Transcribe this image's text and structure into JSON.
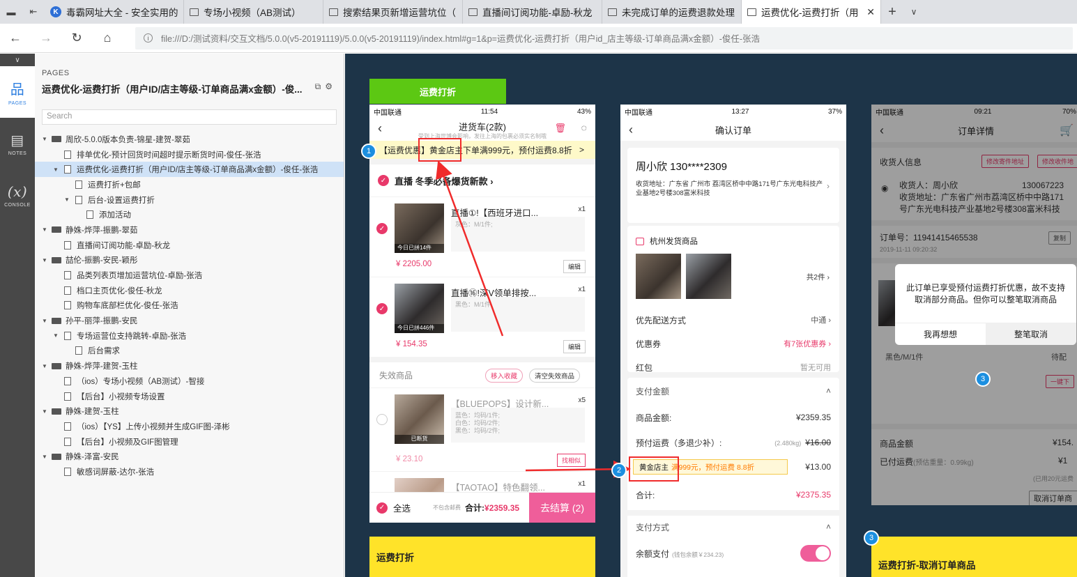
{
  "browser": {
    "tabs": [
      {
        "title": "毒霸网址大全 - 安全实用的",
        "icon": "kingsoft-k-icon"
      },
      {
        "title": "专场小视频（AB测试）",
        "icon": "page-icon"
      },
      {
        "title": "搜索结果页新增运营坑位（",
        "icon": "page-icon"
      },
      {
        "title": "直播间订阅功能-卓励-秋龙",
        "icon": "page-icon"
      },
      {
        "title": "未完成订单的运费退款处理",
        "icon": "page-icon"
      },
      {
        "title": "运费优化-运费打折（用",
        "icon": "page-icon",
        "active": true
      }
    ],
    "url": "file:///D:/测试资料/交互文档/5.0.0(v5-20191119)/5.0.0(v5-20191119)/index.html#g=1&p=运费优化-运费打折（用户id_店主等级-订单商品满x金额）-俊任-张浩"
  },
  "rail": {
    "items": [
      {
        "label": "PAGES",
        "icon": "sitemap-icon",
        "active": true
      },
      {
        "label": "NOTES",
        "icon": "notes-icon"
      },
      {
        "label": "CONSOLE",
        "icon": "variable-x-icon",
        "glyph": "(x)"
      }
    ]
  },
  "sitemap": {
    "header": "PAGES",
    "page_title": "运费优化-运费打折（用户ID/店主等级-订单商品满x金额）-俊...",
    "search_placeholder": "Search",
    "nodes": [
      {
        "label": "周欣-5.0.0版本负责-锦星-建贺-翠茹",
        "level": 0,
        "type": "folder",
        "expanded": true
      },
      {
        "label": "排单优化-预计回货时间超时提示断货时间-俊任-张浩",
        "level": 1,
        "type": "page"
      },
      {
        "label": "运费优化-运费打折（用户ID/店主等级-订单商品满x金额）-俊任-张浩",
        "level": 1,
        "type": "page",
        "expanded": true,
        "selected": true
      },
      {
        "label": "运费打折+包邮",
        "level": 2,
        "type": "page"
      },
      {
        "label": "后台-设置运费打折",
        "level": 2,
        "type": "page",
        "expanded": true
      },
      {
        "label": "添加活动",
        "level": 3,
        "type": "page"
      },
      {
        "label": "静姝-烨萍-振鹏-翠茹",
        "level": 0,
        "type": "folder",
        "expanded": true
      },
      {
        "label": "直播间订阅功能-卓励-秋龙",
        "level": 1,
        "type": "page"
      },
      {
        "label": "喆伦-振鹏-安民-颖彤",
        "level": 0,
        "type": "folder",
        "expanded": true
      },
      {
        "label": "品类列表页增加运营坑位-卓励-张浩",
        "level": 1,
        "type": "page"
      },
      {
        "label": "档口主页优化-俊任-秋龙",
        "level": 1,
        "type": "page"
      },
      {
        "label": "购物车底部栏优化-俊任-张浩",
        "level": 1,
        "type": "page"
      },
      {
        "label": "孙平-丽萍-振鹏-安民",
        "level": 0,
        "type": "folder",
        "expanded": true
      },
      {
        "label": "专场运营位支持跳转-卓励-张浩",
        "level": 1,
        "type": "page",
        "expanded": true
      },
      {
        "label": "后台需求",
        "level": 2,
        "type": "page"
      },
      {
        "label": "静姝-烨萍-建贺-玉柱",
        "level": 0,
        "type": "folder",
        "expanded": true
      },
      {
        "label": "（ios）专场小视频（AB测试）-智接",
        "level": 1,
        "type": "page"
      },
      {
        "label": "【后台】小视频专场设置",
        "level": 1,
        "type": "page"
      },
      {
        "label": "静姝-建贺-玉柱",
        "level": 0,
        "type": "folder",
        "expanded": true
      },
      {
        "label": "（ios）【YS】上传小视频并生成GIF图-泽彬",
        "level": 1,
        "type": "page"
      },
      {
        "label": "【后台】小视频及GIF图管理",
        "level": 1,
        "type": "page"
      },
      {
        "label": "静姝-泽富-安民",
        "level": 0,
        "type": "folder",
        "expanded": true
      },
      {
        "label": "敏感词屏蔽-达尔-张浩",
        "level": 1,
        "type": "page"
      }
    ]
  },
  "canvas": {
    "green_label": "运费打折",
    "cart": {
      "status": {
        "carrier": "中国联通",
        "time": "11:54",
        "battery": "43%"
      },
      "title": "进货车(2款)",
      "subtitle": "受到上海世博会影响，发往上海的包裹必须实名制哦",
      "banner": "【运费优惠】黄金店主下单满999元，预付运费8.8折",
      "banner_arrow": ">",
      "shop": "直播 冬季必备爆货新款 ›",
      "items": [
        {
          "name": "直播①!【西班牙进口...",
          "qty": "x1",
          "spec": "灰色：M/1件;",
          "price": "¥ 2205.00",
          "tag": "今日已拼14件",
          "action": "编辑"
        },
        {
          "name": "直播⑯!深V领单排按...",
          "qty": "x1",
          "spec": "黑色：M/1件",
          "price": "¥ 154.35",
          "tag": "今日已拼446件",
          "action": "编辑"
        }
      ],
      "invalid_title": "失效商品",
      "move_fav": "移入收藏",
      "clear_invalid": "清空失效商品",
      "invalid_items": [
        {
          "name": "【BLUEPOPS】设计新...",
          "qty": "x5",
          "spec": "蓝色：均码/1件;\n白色：均码/2件;\n黑色：均码/2件;",
          "price": "¥ 23.10",
          "tag": "已断货",
          "action": "找相似"
        },
        {
          "name": "【TAOTAO】特色翻领...",
          "qty": "x1"
        }
      ],
      "select_all": "全选",
      "no_postage": "不包含邮费",
      "total_label": "合计:",
      "total": "¥2359.35",
      "checkout": "去结算 (2)"
    },
    "yellow_note_1": "运费打折",
    "order": {
      "status": {
        "carrier": "中国联通",
        "time": "13:27",
        "battery": "37%"
      },
      "title": "确认订单",
      "name_phone": "周小欣   130****2309",
      "address": "收货地址：广东省 广州市 荔湾区桥中中路171号广东光电科技产业基地2号楼308富米科技",
      "warehouse": "杭州发货商品",
      "count": "共2件 ›",
      "rows": [
        {
          "label": "优先配送方式",
          "value": "中通 ›"
        },
        {
          "label": "优惠券",
          "value": "有7张优惠券 ›"
        },
        {
          "label": "红包",
          "value": "暂无可用"
        }
      ],
      "pay_amount_title": "支付金额",
      "goods_amount_label": "商品金额:",
      "goods_amount": "¥2359.35",
      "prepaid_label": "预付运费（多退少补）:",
      "weight": "(2.480kg)",
      "old_fee": "¥16.00",
      "promo_badge": "黄金店主",
      "promo_text": "满999元，预付运费",
      "promo_discount": "8.8折",
      "new_fee": "¥13.00",
      "sum_label": "合计:",
      "sum": "¥2375.35",
      "pay_method_title": "支付方式",
      "balance_label": "余额支付",
      "balance_note": "(钱包余额￥234.23)"
    },
    "detail": {
      "status": {
        "carrier": "中国联通",
        "time": "09:21",
        "battery": "70%"
      },
      "title": "订单详情",
      "receiver_title": "收货人信息",
      "btn_modify_sender": "修改寄件地址",
      "btn_modify_receiver": "修改收件地",
      "receiver": "收货人：周小欣",
      "phone": "130067223",
      "address": "收货地址：广东省广州市荔湾区桥中中路171号广东光电科技产业基地2号楼308富米科技",
      "order_no": "订单号：11941415465538",
      "order_time": "2019-11-11 09:20:32",
      "copy": "复制",
      "spec": "黑色/M/1件",
      "wait": "待配",
      "follow": "一键下",
      "goods_amount_label": "商品金额",
      "goods_amount": "¥154.",
      "paid_fee_label": "已付运费",
      "paid_fee_note": "(预估重量：0.99kg)",
      "paid_fee": "¥1",
      "discount_note": "(已用20元运费",
      "cancel_btn": "取消订单商品",
      "dialog_msg": "此订单已享受预付运费打折优惠，故不支持取消部分商品。但你可以整笔取消商品",
      "dialog_cancel": "我再想想",
      "dialog_confirm": "整笔取消"
    },
    "yellow_note_3": "运费打折-取消订单商品",
    "markers": [
      "1",
      "2",
      "3",
      "3"
    ]
  }
}
